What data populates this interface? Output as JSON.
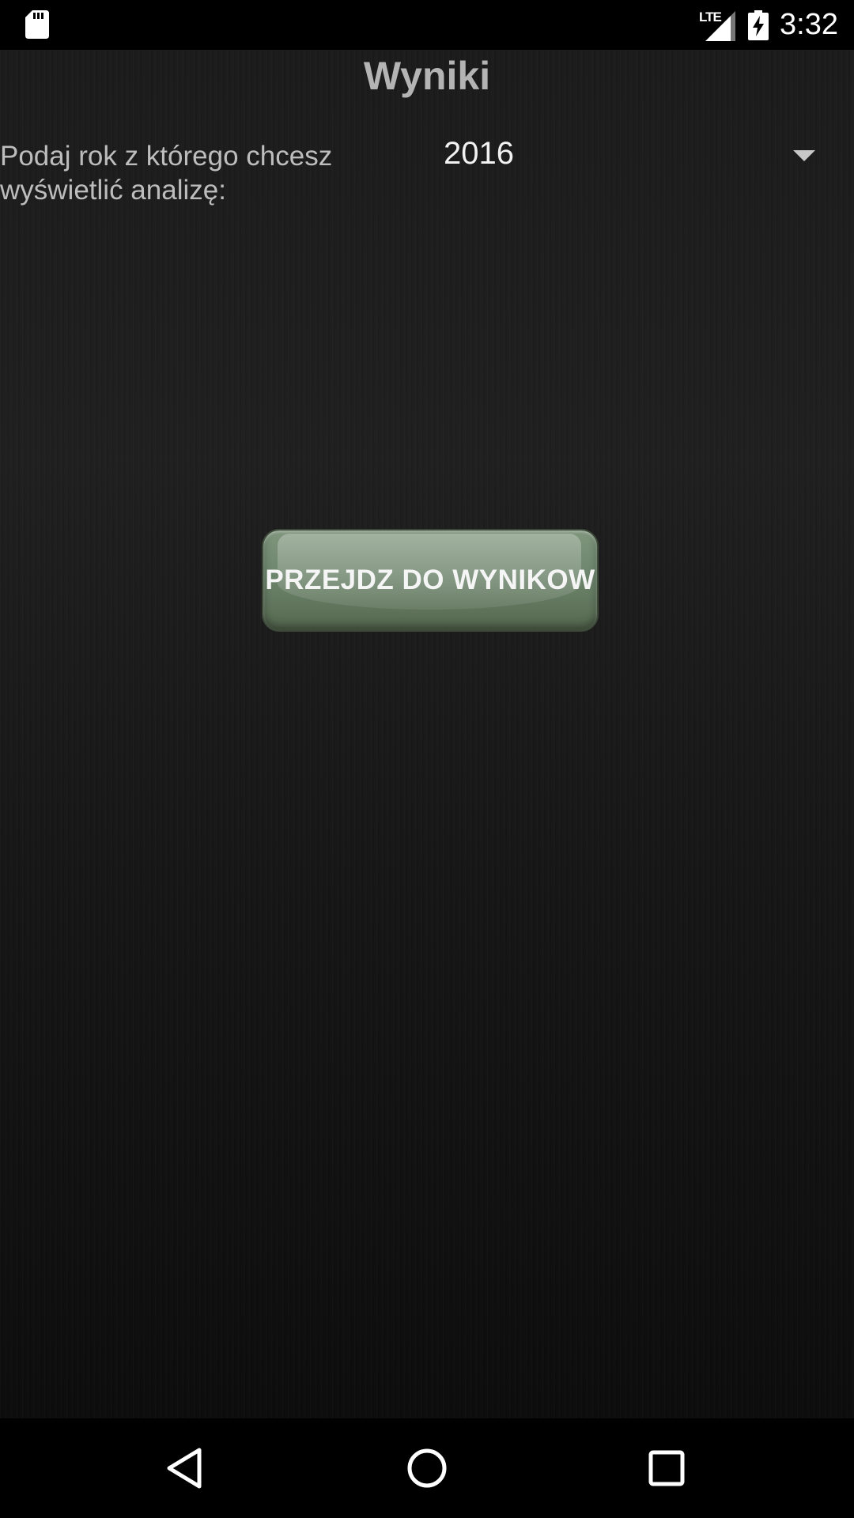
{
  "status_bar": {
    "network": "LTE",
    "time": "3:32",
    "icons": [
      "sd-card-icon",
      "lte-signal-icon",
      "battery-charging-icon"
    ]
  },
  "page": {
    "title": "Wyniki"
  },
  "year_selector": {
    "label": "Podaj rok z którego chcesz wyświetlić analizę:",
    "selected_value": "2016",
    "icon": "dropdown-arrow-icon"
  },
  "results_button": {
    "label": "PRZEJDZ DO WYNIKOW"
  },
  "nav_bar": {
    "icons": [
      "back-icon",
      "home-icon",
      "recents-icon"
    ]
  },
  "colors": {
    "button_green": "#6d856c",
    "title_gray": "#b4b4b4",
    "background": "#1b1b1b"
  }
}
